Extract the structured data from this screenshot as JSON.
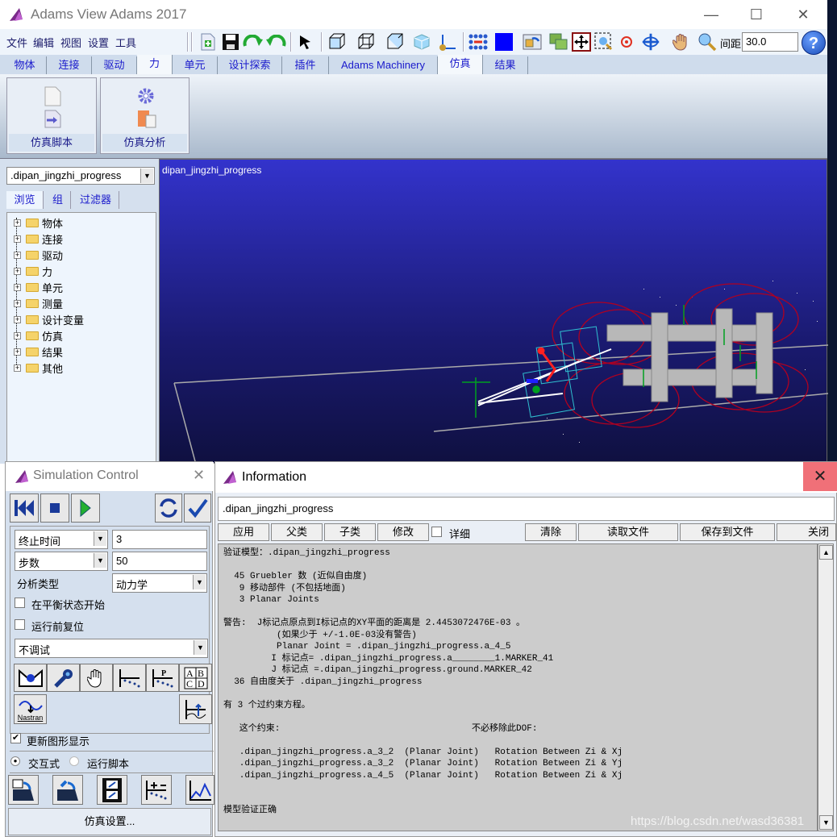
{
  "app": {
    "title": "Adams View Adams 2017",
    "window_controls": {
      "minimize": "—",
      "maximize": "☐",
      "close": "✕"
    }
  },
  "menubar": {
    "items": [
      "文件",
      "编辑",
      "视图",
      "设置",
      "工具"
    ]
  },
  "toolbar": {
    "icons": [
      "new-model-icon",
      "save-icon",
      "redo-icon",
      "undo-icon",
      "select-arrow-icon",
      "view-front-icon",
      "view-wireframe-icon",
      "view-iso-icon",
      "shaded-cube-icon",
      "coordinate-axes-icon",
      "grid-dots-icon",
      "color-fill-icon",
      "render-mode-icon",
      "group-icon",
      "fit-icon",
      "zoom-box-icon",
      "target-icon",
      "rotate-icon",
      "pan-hand-icon",
      "zoom-icon"
    ],
    "spacing_label": "间距",
    "spacing_value": "30.0",
    "help_label": "?"
  },
  "tabs": {
    "items": [
      "物体",
      "连接",
      "驱动",
      "力",
      "单元",
      "设计探索",
      "插件",
      "Adams Machinery",
      "仿真",
      "结果"
    ],
    "active_index": 3
  },
  "ribbon": {
    "buttons": [
      {
        "label": "仿真脚本",
        "icon": "simulation-script-icon"
      },
      {
        "label": "仿真分析",
        "icon": "simulation-analysis-icon"
      }
    ]
  },
  "browser": {
    "model_selector": ".dipan_jingzhi_progress",
    "tabs": [
      "浏览",
      "组",
      "过滤器"
    ],
    "active_tab": 0,
    "tree_items": [
      "物体",
      "连接",
      "驱动",
      "力",
      "单元",
      "测量",
      "设计变量",
      "仿真",
      "结果",
      "其他"
    ]
  },
  "viewport": {
    "model_name": "dipan_jingzhi_progress",
    "colors": {
      "top": "#3333cc",
      "bottom": "#0f1040",
      "wireframe": "#b00020",
      "body": "#b8b8b8",
      "marker": "#00a020"
    }
  },
  "simulation_control": {
    "title": "Simulation Control",
    "end_mode_select": "终止时间",
    "end_value": "3",
    "steps_mode_select": "步数",
    "steps_value": "50",
    "analysis_type_label": "分析类型",
    "analysis_type_value": "动力学",
    "start_at_equilibrium_label": "在平衡状态开始",
    "start_at_equilibrium": false,
    "reset_before_run_label": "运行前复位",
    "reset_before_run": false,
    "debug_select": "不调试",
    "update_graphics_label": "更新图形显示",
    "update_graphics": true,
    "mode_interactive_label": "交互式",
    "mode_script_label": "运行脚本",
    "mode_selected": "交互式",
    "nastran_label": "Nastran",
    "settings_button": "仿真设置..."
  },
  "information": {
    "title": "Information",
    "object_field": ".dipan_jingzhi_progress",
    "buttons": {
      "apply": "应用",
      "parent": "父类",
      "children": "子类",
      "modify": "修改",
      "verbose": "详细",
      "clear": "清除",
      "read_file": "读取文件",
      "save_to_file": "保存到文件",
      "close": "关闭"
    },
    "verbose_checked": false,
    "lines": [
      "验证模型：.dipan_jingzhi_progress",
      "",
      "  45 Gruebler 数 (近似自由度)",
      "   9 移动部件 (不包括地面)",
      "   3 Planar Joints",
      "",
      "警告:  J标记点原点到I标记点的XY平面的距离是 2.4453072476E-03 。",
      "          (如果少于 +/-1.0E-03没有警告)",
      "          Planar Joint = .dipan_jingzhi_progress.a_4_5",
      "         I 标记点= .dipan_jingzhi_progress.a________1.MARKER_41",
      "         J 标记点 =.dipan_jingzhi_progress.ground.MARKER_42",
      "  36 自由度关于 .dipan_jingzhi_progress",
      "",
      "有 3 个过约束方程。",
      "",
      "   这个约束:                                    不必移除此DOF:",
      "",
      "   .dipan_jingzhi_progress.a_3_2  (Planar Joint)   Rotation Between Zi & Xj",
      "   .dipan_jingzhi_progress.a_3_2  (Planar Joint)   Rotation Between Zi & Yj",
      "   .dipan_jingzhi_progress.a_4_5  (Planar Joint)   Rotation Between Zi & Xj",
      "",
      "",
      "模型验证正确"
    ]
  },
  "watermark": "https://blog.csdn.net/wasd36381"
}
